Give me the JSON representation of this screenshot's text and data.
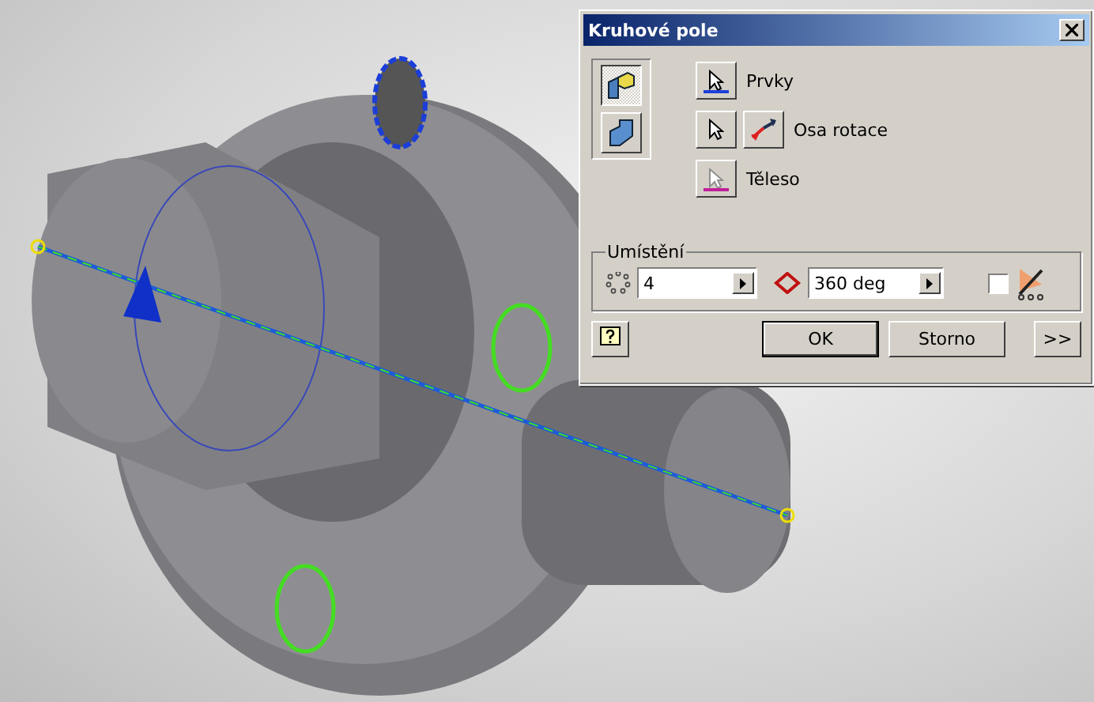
{
  "dialog": {
    "title": "Kruhové pole",
    "modes": [
      {
        "kind": "features",
        "selected": true
      },
      {
        "kind": "body",
        "selected": false
      }
    ],
    "selectors": [
      {
        "label": "Prvky",
        "kind": "single",
        "color": "#1f3fd8",
        "disabled": false
      },
      {
        "label": "Osa rotace",
        "kind": "flip",
        "disabled": false
      },
      {
        "label": "Těleso",
        "kind": "single",
        "color": "#c0209a",
        "disabled": true
      }
    ],
    "placement": {
      "title": "Umístění",
      "count": "4",
      "angle": "360 deg",
      "fit_checked": false
    },
    "buttons": [
      {
        "label": "OK",
        "kind": "default"
      },
      {
        "label": "Storno",
        "kind": "normal"
      },
      {
        "label": ">>",
        "kind": "small"
      }
    ]
  }
}
